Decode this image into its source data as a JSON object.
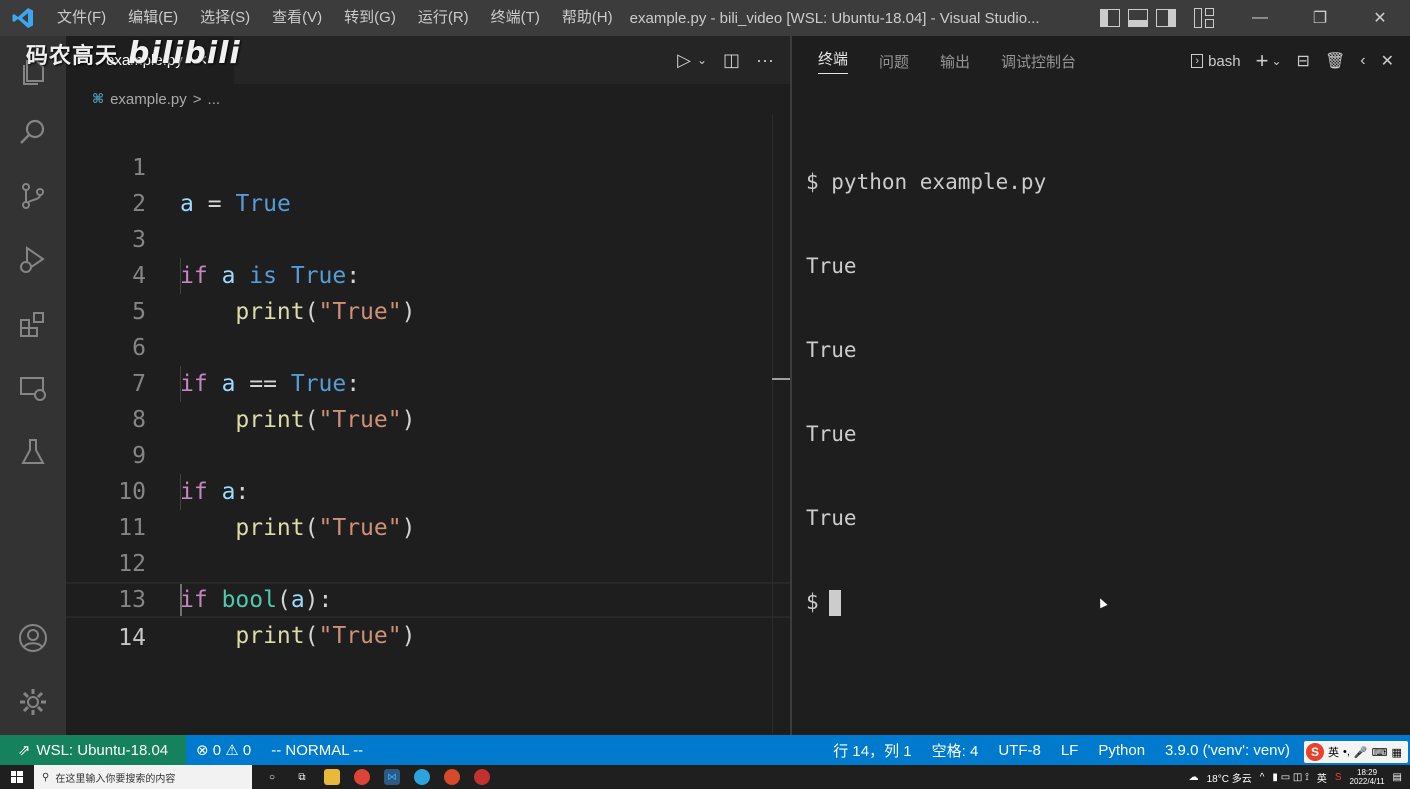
{
  "titlebar": {
    "menus": [
      "文件(F)",
      "编辑(E)",
      "选择(S)",
      "查看(V)",
      "转到(G)",
      "运行(R)",
      "终端(T)",
      "帮助(H)"
    ],
    "window_title": "example.py - bili_video [WSL: Ubuntu-18.04] - Visual Studio...",
    "minimize": "—",
    "restore": "❐",
    "close": "✕"
  },
  "watermark": {
    "text": "码农高天",
    "logo": "bilibili"
  },
  "activity_bar": [
    "files-icon",
    "search-icon",
    "source-control-icon",
    "run-debug-icon",
    "extensions-icon",
    "remote-explorer-icon",
    "testing-icon",
    "account-icon",
    "settings-gear-icon"
  ],
  "editor": {
    "tab_label": "example.py",
    "tab_close": "✕",
    "breadcrumb_file": "example.py",
    "breadcrumb_sep": ">",
    "breadcrumb_more": "...",
    "line_numbers": [
      "1",
      "2",
      "3",
      "4",
      "5",
      "6",
      "7",
      "8",
      "9",
      "10",
      "11",
      "12",
      "13",
      "14"
    ],
    "lines": [
      "a = True",
      "",
      "if a is True:",
      "    print(\"True\")",
      "",
      "if a == True:",
      "    print(\"True\")",
      "",
      "if a:",
      "    print(\"True\")",
      "",
      "if bool(a):",
      "    print(\"True\")",
      ""
    ]
  },
  "panel": {
    "tabs": [
      "终端",
      "问题",
      "输出",
      "调试控制台"
    ],
    "active_tab": "终端",
    "shell": "bash",
    "terminal_lines": [
      "$ python example.py",
      "True",
      "True",
      "True",
      "True"
    ],
    "prompt": "$"
  },
  "statusbar": {
    "remote": "WSL: Ubuntu-18.04",
    "errors": "0",
    "warnings": "0",
    "mode": "-- NORMAL --",
    "position": "行 14，列 1",
    "spaces": "空格: 4",
    "encoding": "UTF-8",
    "eol": "LF",
    "language": "Python",
    "interpreter": "3.9.0 ('venv': venv)",
    "ime_lang": "英"
  },
  "taskbar": {
    "search_placeholder": "在这里输入你要搜索的内容",
    "weather": "18°C 多云",
    "ime": "英",
    "time": "18:29",
    "date": "2022/4/11"
  },
  "colors": {
    "accent": "#007acc",
    "remote": "#16825d",
    "keyword": "#c586c0",
    "constant": "#569cd6",
    "string": "#ce9178",
    "function": "#dcdcaa",
    "variable": "#9cdcfe"
  }
}
